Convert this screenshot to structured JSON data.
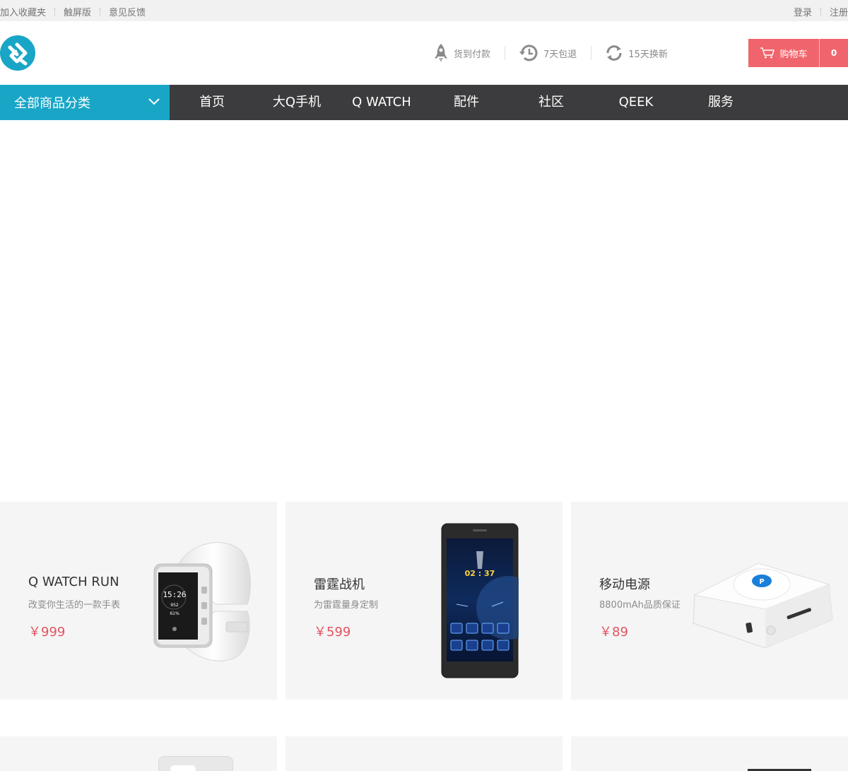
{
  "topbar": {
    "left_links": [
      "加入收藏夹",
      "触屏版",
      "意见反馈"
    ],
    "right_links": [
      "登录",
      "注册"
    ]
  },
  "header": {
    "logo_icon": "brand-logo-icon",
    "services": [
      {
        "icon": "rocket-icon",
        "label": "货到付款"
      },
      {
        "icon": "clock-return-icon",
        "label": "7天包退"
      },
      {
        "icon": "refresh-icon",
        "label": "15天换新"
      }
    ],
    "cart": {
      "icon": "cart-icon",
      "label": "购物车",
      "count": "0"
    }
  },
  "nav": {
    "all_categories": "全部商品分类",
    "items": [
      "首页",
      "大Q手机",
      "Q WATCH",
      "配件",
      "社区",
      "QEEK",
      "服务"
    ]
  },
  "products": [
    {
      "name": "Q WATCH RUN",
      "desc": "改变你生活的一款手表",
      "price": "￥999",
      "image": "smartwatch-image"
    },
    {
      "name": "雷霆战机",
      "desc": "为雷霆量身定制",
      "price": "￥599",
      "image": "phone-image"
    },
    {
      "name": "移动电源",
      "desc": "8800mAh品质保证",
      "price": "￥89",
      "image": "power-bank-image"
    }
  ],
  "watch_screen": {
    "time": "15:26",
    "steps": "952",
    "percent": "61%"
  },
  "phone_screen": {
    "time": "02 : 37"
  },
  "colors": {
    "accent": "#19a6c6",
    "nav_bg": "#3c3c3e",
    "cart": "#f0656d",
    "price": "#e45361"
  }
}
